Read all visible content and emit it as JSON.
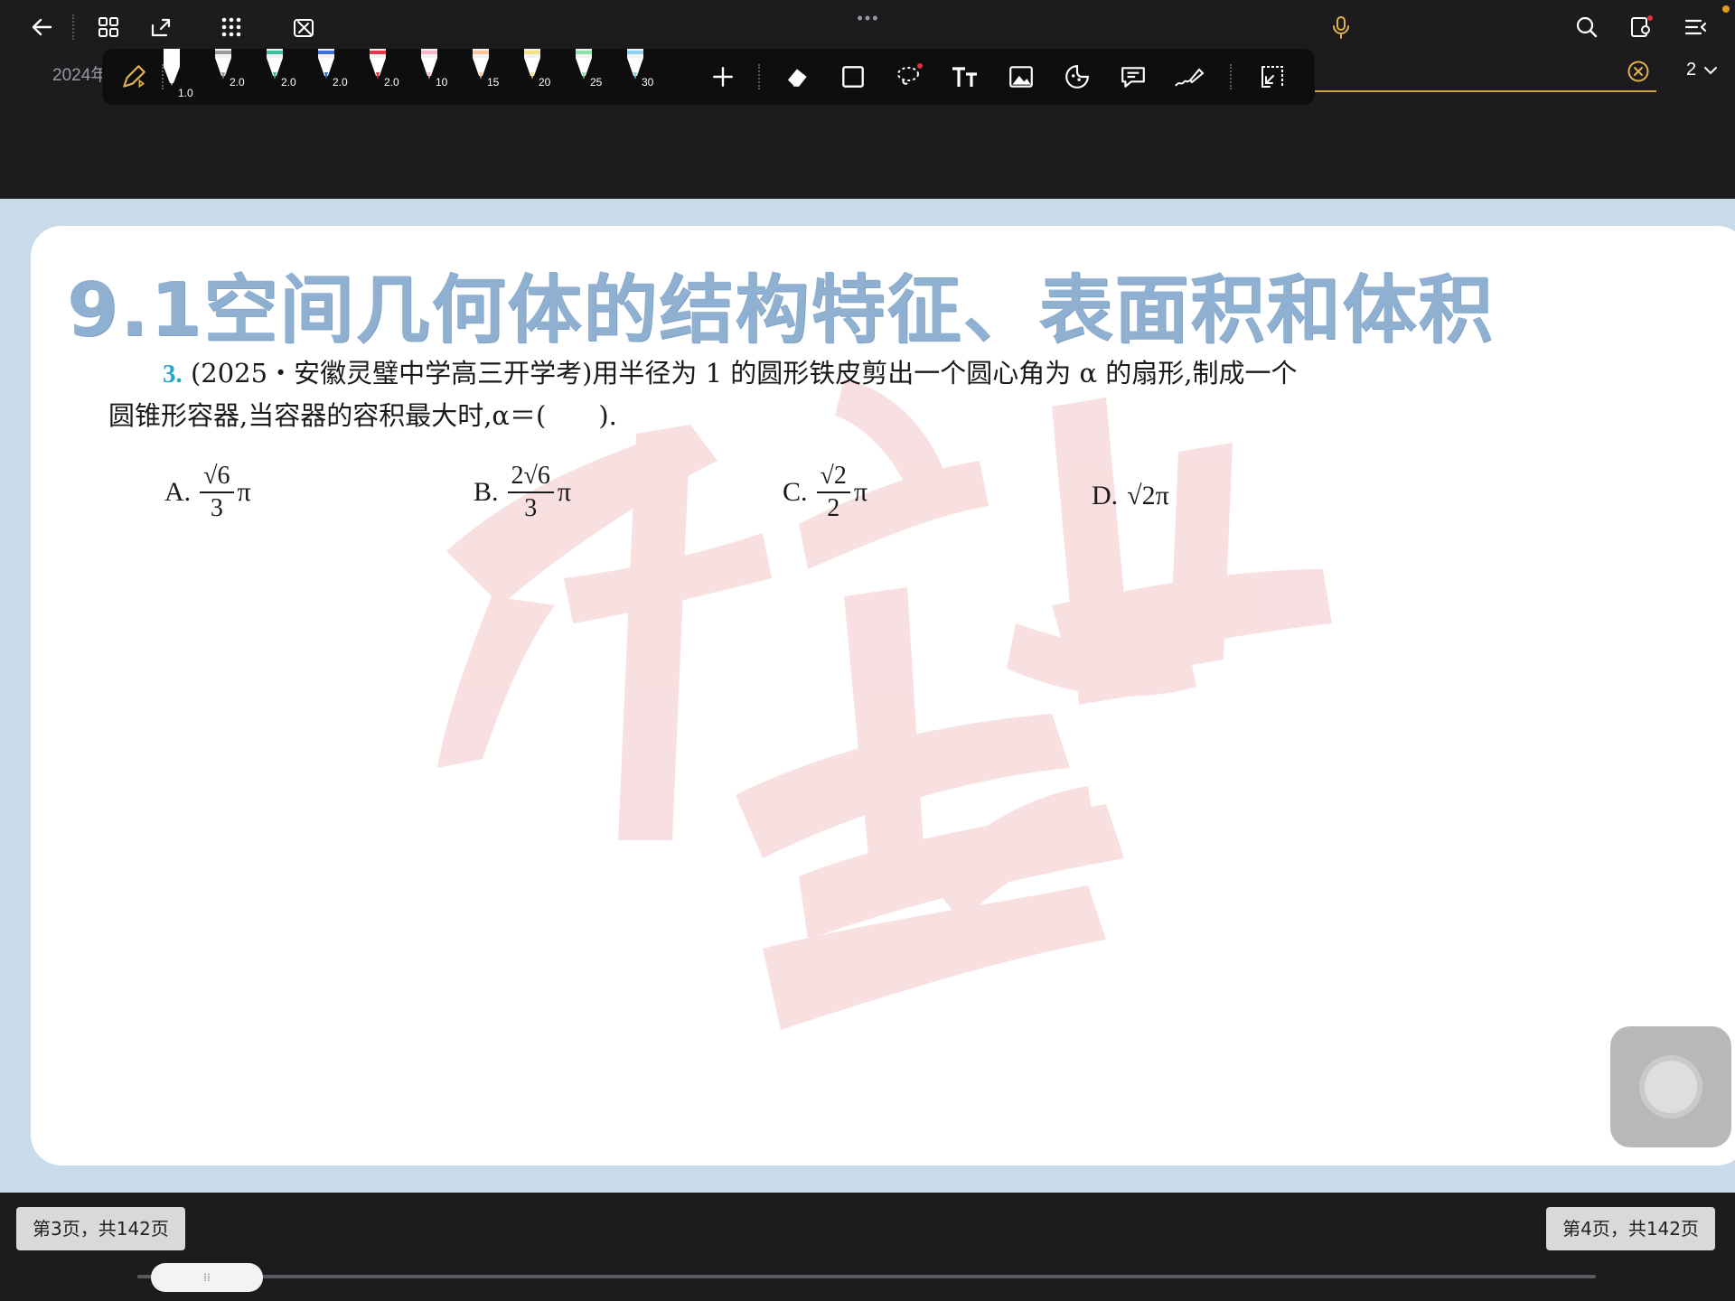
{
  "app": {
    "document_title": "2024年",
    "page_select": "2",
    "accent_color": "#c9a24a"
  },
  "top_bar": {
    "icons": [
      "back-arrow-icon",
      "grid-icon",
      "export-icon",
      "apps-icon",
      "pencil-off-icon",
      "more-dots-icon",
      "microphone-icon",
      "search-icon",
      "page-settings-icon",
      "menu-collapse-icon"
    ]
  },
  "pen_toolbar": {
    "pens": [
      {
        "size": "1.0",
        "color": "#ffffff"
      },
      {
        "size": "2.0",
        "color": "#9b9b9b"
      },
      {
        "size": "2.0",
        "color": "#3fbf9f"
      },
      {
        "size": "2.0",
        "color": "#3d6fd8"
      },
      {
        "size": "2.0",
        "color": "#e03a4a"
      },
      {
        "size": "10",
        "color": "#f4b8cc"
      },
      {
        "size": "15",
        "color": "#f6c79e"
      },
      {
        "size": "20",
        "color": "#f4e08a"
      },
      {
        "size": "25",
        "color": "#8ee0a8"
      },
      {
        "size": "30",
        "color": "#8fd0ef"
      }
    ],
    "tools": [
      "add-pen-icon",
      "eraser-icon",
      "shape-icon",
      "lasso-icon",
      "text-icon",
      "image-icon",
      "sticker-icon",
      "comment-icon",
      "highlighter-laser-icon",
      "collapse-toolbar-icon"
    ]
  },
  "page": {
    "section_title": "9.1空间几何体的结构特征、表面积和体积",
    "question_number": "3.",
    "question_text_line1": "(2025・安徽灵璧中学高三开学考)用半径为 1 的圆形铁皮剪出一个圆心角为 α 的扇形,制成一个",
    "question_text_line2": "圆锥形容器,当容器的容积最大时,α＝(　　).",
    "options": [
      {
        "label": "A.",
        "num": "√6",
        "den": "3",
        "suffix": "π"
      },
      {
        "label": "B.",
        "num": "2√6",
        "den": "3",
        "suffix": "π"
      },
      {
        "label": "C.",
        "num": "√2",
        "den": "2",
        "suffix": "π"
      },
      {
        "label": "D.",
        "expr": "√2",
        "suffix": "π"
      }
    ]
  },
  "bottom_bar": {
    "left_page_label": "第3页，共142页",
    "right_page_label": "第4页，共142页",
    "slider_handle": "⁞⁞"
  }
}
